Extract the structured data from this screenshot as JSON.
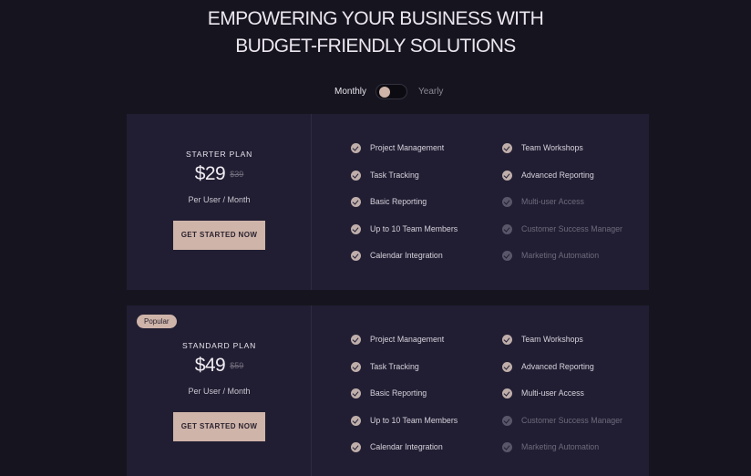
{
  "headline": {
    "line1": "EMPOWERING YOUR BUSINESS WITH",
    "line2": "BUDGET-FRIENDLY SOLUTIONS"
  },
  "billing": {
    "monthly_label": "Monthly",
    "yearly_label": "Yearly",
    "selected": "Monthly"
  },
  "colors": {
    "accent": "#cfb4a9",
    "card": "#211e33",
    "background": "#16151f"
  },
  "plans": [
    {
      "name": "STARTER PLAN",
      "badge": "",
      "price": "$29",
      "old_price": "$39",
      "period": "Per User / Month",
      "cta": "GET STARTED NOW",
      "features_a": [
        {
          "label": "Project Management",
          "included": true
        },
        {
          "label": "Task Tracking",
          "included": true
        },
        {
          "label": "Basic Reporting",
          "included": true
        },
        {
          "label": "Up to 10 Team Members",
          "included": true
        },
        {
          "label": "Calendar Integration",
          "included": true
        }
      ],
      "features_b": [
        {
          "label": "Team Workshops",
          "included": true
        },
        {
          "label": "Advanced Reporting",
          "included": true
        },
        {
          "label": "Multi-user Access",
          "included": false
        },
        {
          "label": "Customer Success Manager",
          "included": false
        },
        {
          "label": "Marketing Automation",
          "included": false
        }
      ]
    },
    {
      "name": "STANDARD PLAN",
      "badge": "Popular",
      "price": "$49",
      "old_price": "$59",
      "period": "Per User / Month",
      "cta": "GET STARTED NOW",
      "features_a": [
        {
          "label": "Project Management",
          "included": true
        },
        {
          "label": "Task Tracking",
          "included": true
        },
        {
          "label": "Basic Reporting",
          "included": true
        },
        {
          "label": "Up to 10 Team Members",
          "included": true
        },
        {
          "label": "Calendar Integration",
          "included": true
        }
      ],
      "features_b": [
        {
          "label": "Team Workshops",
          "included": true
        },
        {
          "label": "Advanced Reporting",
          "included": true
        },
        {
          "label": "Multi-user Access",
          "included": true
        },
        {
          "label": "Customer Success Manager",
          "included": false
        },
        {
          "label": "Marketing Automation",
          "included": false
        }
      ]
    }
  ]
}
